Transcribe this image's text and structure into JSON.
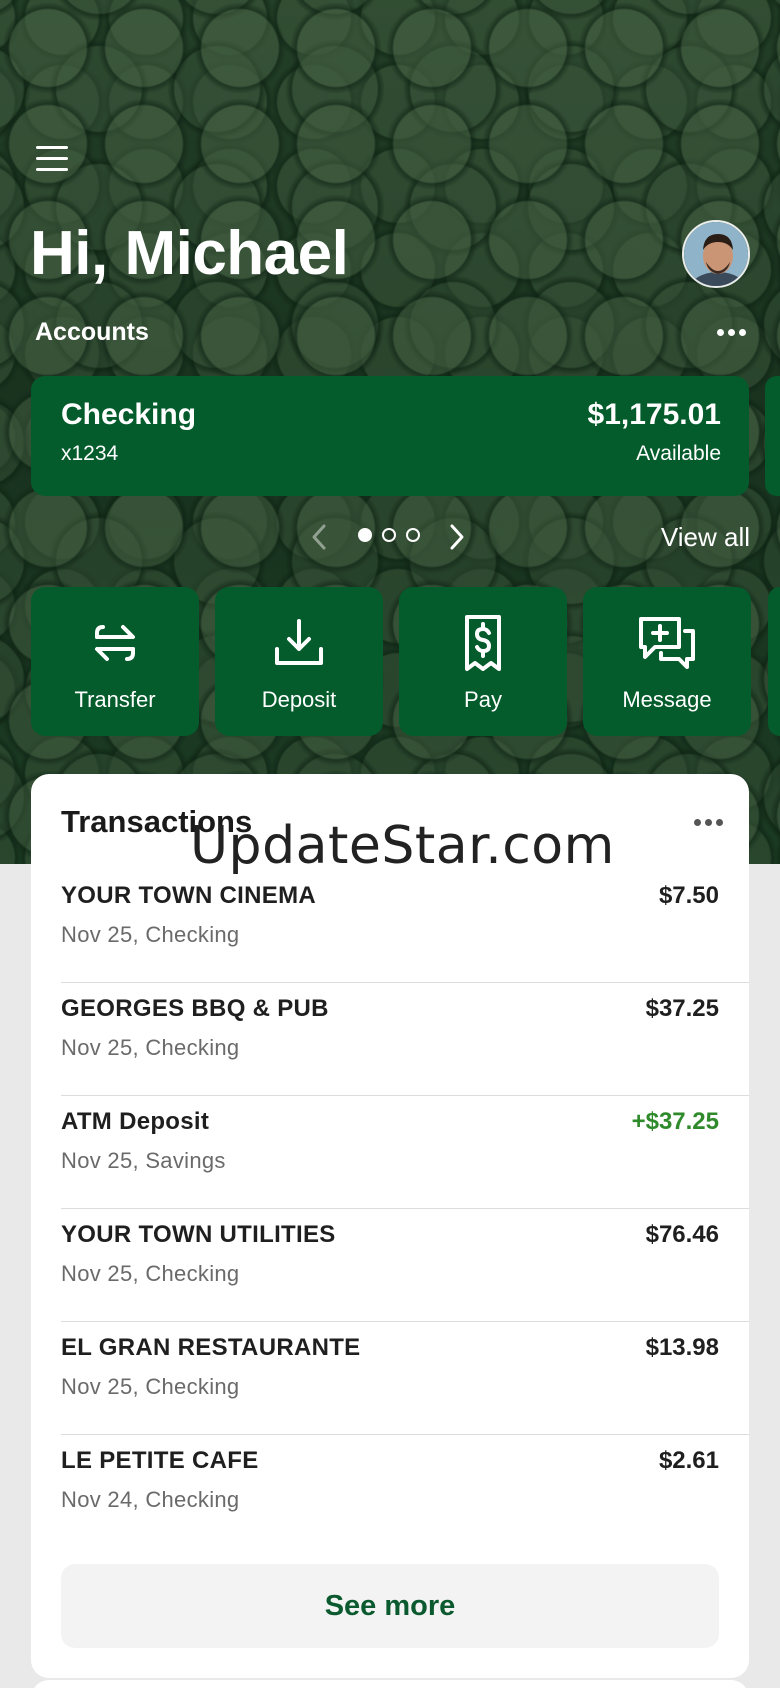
{
  "header": {
    "greeting": "Hi, Michael"
  },
  "accounts": {
    "section_label": "Accounts",
    "card": {
      "name": "Checking",
      "number": "x1234",
      "balance": "$1,175.01",
      "balance_label": "Available"
    },
    "carousel": {
      "pages": 3,
      "active_page": 1
    },
    "view_all_label": "View all"
  },
  "actions": [
    {
      "label": "Transfer",
      "icon": "transfer-icon"
    },
    {
      "label": "Deposit",
      "icon": "deposit-icon"
    },
    {
      "label": "Pay",
      "icon": "pay-bill-icon"
    },
    {
      "label": "Message",
      "icon": "message-icon"
    }
  ],
  "transactions": {
    "title": "Transactions",
    "items": [
      {
        "merchant": "YOUR TOWN CINEMA",
        "meta": "Nov 25, Checking",
        "amount": "$7.50",
        "credit": false
      },
      {
        "merchant": "GEORGES BBQ & PUB",
        "meta": "Nov 25, Checking",
        "amount": "$37.25",
        "credit": false
      },
      {
        "merchant": "ATM Deposit",
        "meta": "Nov 25, Savings",
        "amount": "+$37.25",
        "credit": true
      },
      {
        "merchant": "YOUR TOWN UTILITIES",
        "meta": "Nov 25, Checking",
        "amount": "$76.46",
        "credit": false
      },
      {
        "merchant": "EL GRAN RESTAURANTE",
        "meta": "Nov 25, Checking",
        "amount": "$13.98",
        "credit": false
      },
      {
        "merchant": "LE PETITE CAFE",
        "meta": "Nov 24, Checking",
        "amount": "$2.61",
        "credit": false
      }
    ],
    "see_more_label": "See more"
  },
  "watermark": "UpdateStar.com",
  "colors": {
    "brand_green": "#045b2b",
    "credit_green": "#2f8a2b",
    "see_more_text": "#0b5a2f"
  }
}
